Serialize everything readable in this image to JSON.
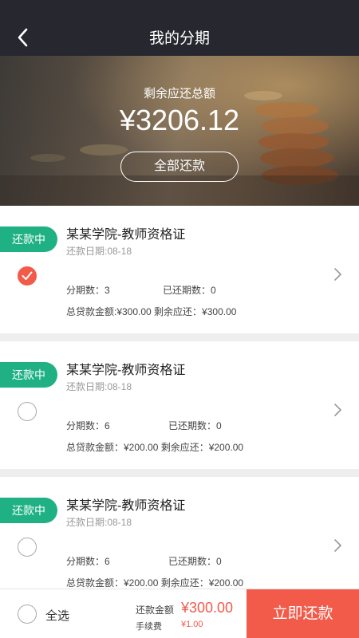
{
  "nav": {
    "title": "我的分期",
    "back_icon": "chevron-left-icon"
  },
  "summary": {
    "label": "剩余应还总额",
    "amount": "¥3206.12",
    "repay_all": "全部还款"
  },
  "loans": [
    {
      "status": "还款中",
      "title": "某某学院-教师资格证",
      "date": "还款日期:08-18",
      "periods": "分期数：3",
      "paid": "已还期数：0",
      "total_line": "总贷款金额:¥300.00 剩余应还：¥300.00",
      "checked": true
    },
    {
      "status": "还款中",
      "title": "某某学院-教师资格证",
      "date": "还款日期:08-18",
      "periods": "分期数：6",
      "paid": "已还期数：0",
      "total_line": "总贷款金额：¥200.00 剩余应还：¥200.00",
      "checked": false
    },
    {
      "status": "还款中",
      "title": "某某学院-教师资格证",
      "date": "还款日期:08-18",
      "periods": "分期数：6",
      "paid": "已还期数：0",
      "total_line": "总贷款金额：¥200.00 剩余应还：¥200.00",
      "checked": false
    }
  ],
  "footer": {
    "select_all": "全选",
    "repay_label": "还款金额",
    "repay_amount": "¥300.00",
    "fee_label": "手续费",
    "fee_amount": "¥1.00",
    "pay_now": "立即还款"
  },
  "colors": {
    "accent": "#f25a4a",
    "status_green": "#1fb184",
    "nav_bg": "#27282f"
  }
}
